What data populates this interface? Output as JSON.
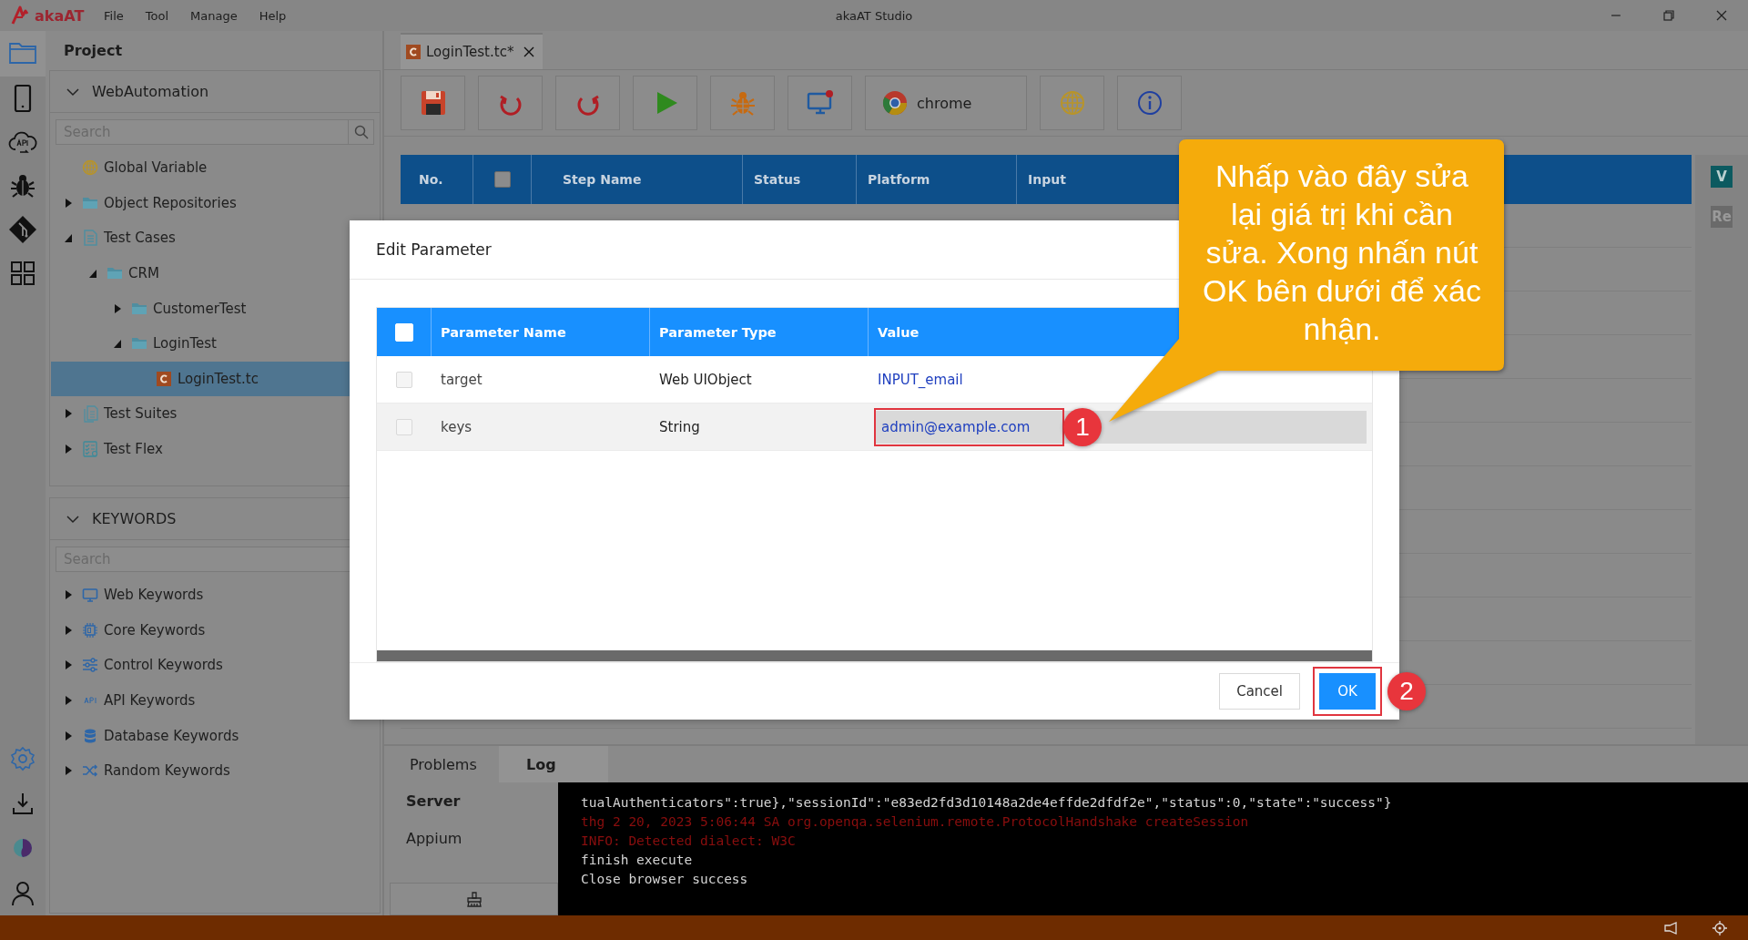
{
  "window": {
    "logo": "akaAT",
    "title": "akaAT Studio",
    "menu": [
      "File",
      "Tool",
      "Manage",
      "Help"
    ]
  },
  "activity_bar": {
    "top": [
      {
        "kind": "folder",
        "selected": true
      },
      {
        "kind": "mobile",
        "selected": false
      },
      {
        "kind": "api",
        "selected": false
      },
      {
        "kind": "bug",
        "selected": false
      },
      {
        "kind": "git",
        "selected": false
      },
      {
        "kind": "grid",
        "selected": false
      }
    ],
    "bottom": [
      {
        "kind": "settings"
      },
      {
        "kind": "download"
      },
      {
        "kind": "brand"
      },
      {
        "kind": "user"
      }
    ]
  },
  "project_panel": {
    "title": "Project",
    "section": {
      "title": "WebAutomation",
      "expanded": true
    },
    "search": {
      "placeholder": "Search"
    },
    "tree": [
      {
        "label": "Global Variable",
        "kind": "globe",
        "selected": false
      },
      {
        "label": "Object Repositories",
        "kind": "folder",
        "expanded": false,
        "selected": false
      },
      {
        "label": "Test Cases",
        "kind": "document",
        "expanded": true,
        "selected": false,
        "children": [
          {
            "label": "CRM",
            "kind": "folder",
            "expanded": true,
            "selected": false,
            "children": [
              {
                "label": "CustomerTest",
                "kind": "folder",
                "expanded": false,
                "selected": false
              },
              {
                "label": "LoginTest",
                "kind": "folder",
                "expanded": true,
                "selected": false,
                "children": [
                  {
                    "label": "LoginTest.tc",
                    "kind": "testcase",
                    "selected": true
                  }
                ]
              }
            ]
          }
        ]
      },
      {
        "label": "Test Suites",
        "kind": "suites",
        "expanded": false,
        "selected": false
      },
      {
        "label": "Test Flex",
        "kind": "checklist",
        "expanded": false,
        "selected": false
      }
    ]
  },
  "keywords_panel": {
    "title": "KEYWORDS",
    "expanded": true,
    "search": {
      "placeholder": "Search"
    },
    "items": [
      {
        "label": "Web Keywords",
        "kind": "monitor",
        "expanded": false
      },
      {
        "label": "Core Keywords",
        "kind": "chip",
        "expanded": false
      },
      {
        "label": "Control Keywords",
        "kind": "sliders",
        "expanded": false
      },
      {
        "label": "API Keywords",
        "kind": "api",
        "expanded": false
      },
      {
        "label": "Database Keywords",
        "kind": "database",
        "expanded": false
      },
      {
        "label": "Random Keywords",
        "kind": "shuffle",
        "expanded": false
      }
    ]
  },
  "editor": {
    "tabs": [
      {
        "label": "LoginTest.tc*",
        "selected": true
      }
    ],
    "toolbar": [
      {
        "kind": "save"
      },
      {
        "kind": "undo"
      },
      {
        "kind": "redo"
      },
      {
        "kind": "run"
      },
      {
        "kind": "debug"
      },
      {
        "kind": "remote"
      },
      {
        "kind": "browser",
        "label": "chrome"
      },
      {
        "kind": "web"
      },
      {
        "kind": "info"
      }
    ],
    "table": {
      "columns": [
        {
          "kind": "text",
          "label": "No."
        },
        {
          "kind": "checkbox",
          "checked": false
        },
        {
          "kind": "text",
          "label": "Step Name"
        },
        {
          "kind": "text",
          "label": "Status"
        },
        {
          "kind": "text",
          "label": "Platform"
        },
        {
          "kind": "text",
          "label": "Input"
        }
      ]
    },
    "side_badges": [
      {
        "label": "V",
        "kind": "active"
      },
      {
        "label": "Re",
        "kind": "inactive"
      }
    ]
  },
  "bottom_panel": {
    "tabs": [
      {
        "label": "Problems",
        "selected": false
      },
      {
        "label": "Log",
        "selected": true
      }
    ],
    "servers": [
      {
        "label": "Server",
        "selected": true
      },
      {
        "label": "Appium",
        "selected": false
      }
    ],
    "console": [
      {
        "kind": "stdout",
        "text": "tualAuthenticators\":true},\"sessionId\":\"e83ed2fd3d10148a2de4effde2dfdf2e\",\"status\":0,\"state\":\"success\"}"
      },
      {
        "kind": "stderr",
        "text": "thg 2 20, 2023 5:06:44 SA org.openqa.selenium.remote.ProtocolHandshake createSession"
      },
      {
        "kind": "stderr",
        "text": "INFO: Detected dialect: W3C"
      },
      {
        "kind": "stdout",
        "text": "finish execute"
      },
      {
        "kind": "stdout",
        "text": "Close browser success"
      }
    ]
  },
  "dialog": {
    "title": "Edit Parameter",
    "header_checkbox": {
      "checked": false
    },
    "columns": [
      "Parameter Name",
      "Parameter Type",
      "Value"
    ],
    "rows": [
      {
        "checked": false,
        "name": "target",
        "type": "Web UIObject",
        "value": "INPUT_email",
        "editing": false
      },
      {
        "checked": false,
        "name": "keys",
        "type": "String",
        "value": "admin@example.com",
        "editing": true
      }
    ],
    "buttons": [
      {
        "label": "Cancel",
        "kind": "default"
      },
      {
        "label": "OK",
        "kind": "primary"
      }
    ]
  },
  "annotations": {
    "callout": "Nhấp vào đây sửa lại giá trị khi cần sửa. Xong nhấn nút OK bên dưới để xác nhận.",
    "markers": [
      "1",
      "2"
    ]
  }
}
